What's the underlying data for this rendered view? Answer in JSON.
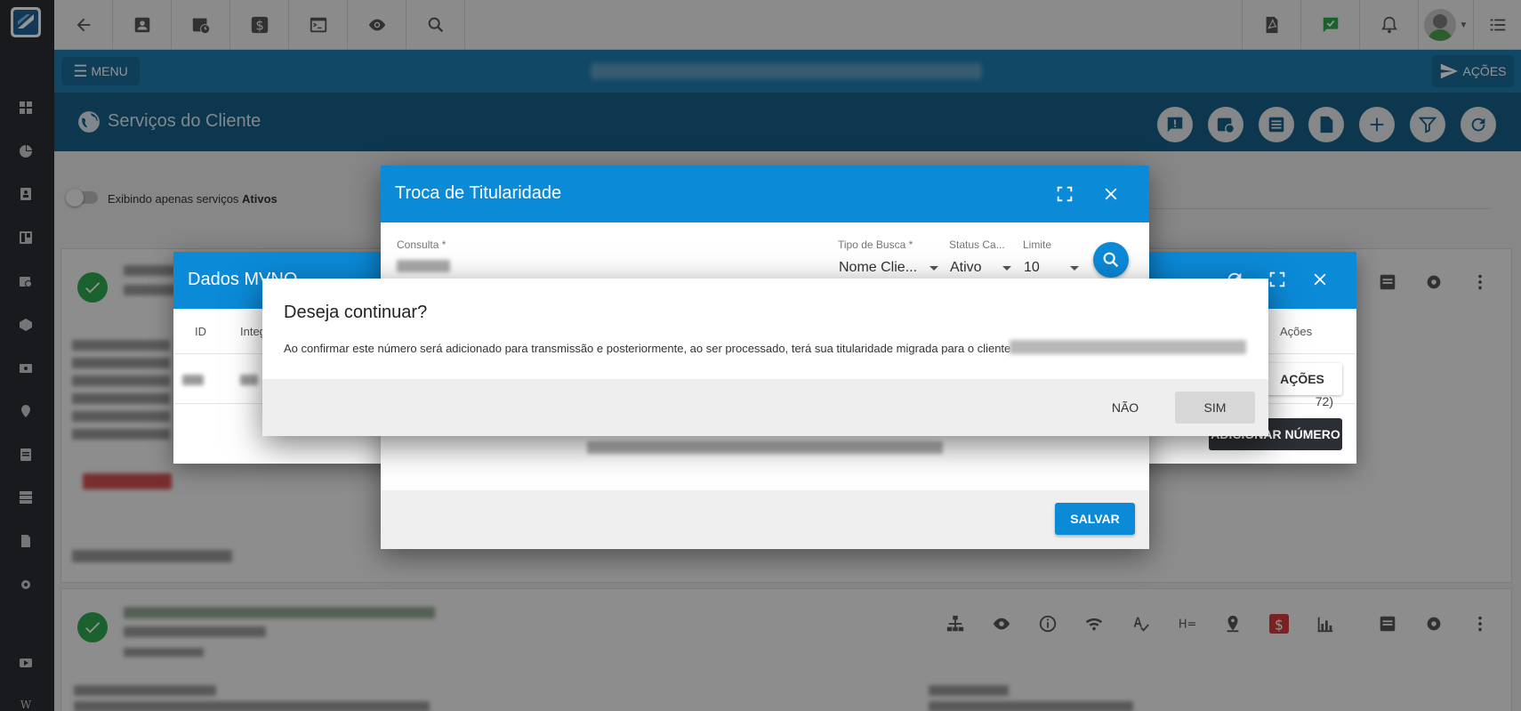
{
  "topbar": {
    "icons": [
      "back-arrow-icon",
      "contact-card-icon",
      "calendar-clock-icon",
      "dollar-icon",
      "terminal-icon",
      "eye-icon",
      "search-icon",
      "pdf-icon",
      "chat-check-icon",
      "bell-icon",
      "avatar",
      "list-icon"
    ]
  },
  "sidebar": {
    "icons": [
      "grid-icon",
      "pie-chart-icon",
      "contact-icon",
      "board-icon",
      "calendar-icon",
      "box-icon",
      "money-icon",
      "location-icon",
      "document-icon",
      "server-icon",
      "file-icon",
      "gear-icon",
      "youtube-icon",
      "wikipedia-icon"
    ],
    "bottom_label": "W"
  },
  "header": {
    "menu_label": "MENU",
    "actions_label": "AÇÕES"
  },
  "page": {
    "title": "Serviços do Cliente",
    "toggle_text": "Exibindo apenas serviços",
    "toggle_bold": "Ativos"
  },
  "mvno_dialog": {
    "title": "Dados MVNO",
    "col_id": "ID",
    "col_integ": "Integ",
    "col_acoes": "Ações",
    "acoes_button": "AÇÕES",
    "add_number_button": "ADICIONAR NÚMERO",
    "paren_text": "72)"
  },
  "troca_dialog": {
    "title": "Troca de Titularidade",
    "consulta_label": "Consulta *",
    "tipo_busca_label": "Tipo de Busca *",
    "tipo_busca_value": "Nome Clie...",
    "status_label": "Status Ca...",
    "status_value": "Ativo",
    "limite_label": "Limite",
    "limite_value": "10",
    "save_button": "SALVAR"
  },
  "confirm_dialog": {
    "title": "Deseja continuar?",
    "message": "Ao confirmar este número será adicionado para transmissão e posteriormente, ao ser processado, terá sua titularidade migrada para o cliente",
    "no_button": "NÃO",
    "yes_button": "SIM"
  },
  "colors": {
    "accent_blue": "#0b8ad8",
    "header_blue": "#1e7cb0",
    "title_blue": "#175f87",
    "status_green": "#2fa84f"
  }
}
